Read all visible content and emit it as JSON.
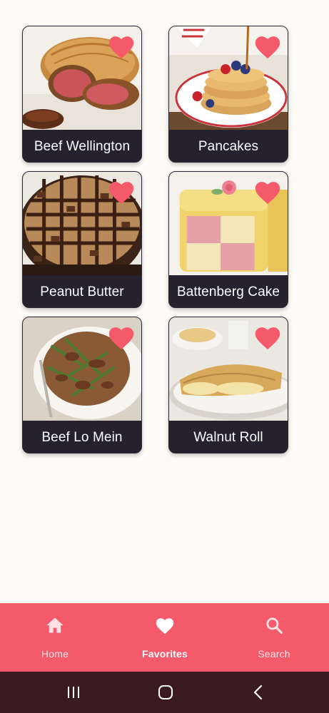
{
  "recipes": [
    {
      "title": "Beef Wellington",
      "favorite": true,
      "image": "beef-wellington-photo"
    },
    {
      "title": "Pancakes",
      "favorite": true,
      "image": "pancakes-photo"
    },
    {
      "title": "Peanut Butter",
      "favorite": true,
      "image": "peanut-butter-pie-photo"
    },
    {
      "title": "Battenberg Cake",
      "favorite": true,
      "image": "battenberg-cake-photo"
    },
    {
      "title": "Beef Lo Mein",
      "favorite": true,
      "image": "beef-lo-mein-photo"
    },
    {
      "title": "Walnut Roll",
      "favorite": true,
      "image": "walnut-roll-photo"
    }
  ],
  "bottom_nav": {
    "items": [
      {
        "label": "Home",
        "icon": "home-icon",
        "active": false
      },
      {
        "label": "Favorites",
        "icon": "heart-icon",
        "active": true
      },
      {
        "label": "Search",
        "icon": "search-icon",
        "active": false
      }
    ]
  },
  "system_nav": {
    "buttons": [
      "recents-icon",
      "home-circle-icon",
      "back-icon"
    ]
  },
  "colors": {
    "background": "#fdfbf5",
    "card_title_bg": "#25212d",
    "heart": "#f55a6a",
    "nav_bar": "#f55a6a",
    "system_nav": "#3a1c20"
  }
}
